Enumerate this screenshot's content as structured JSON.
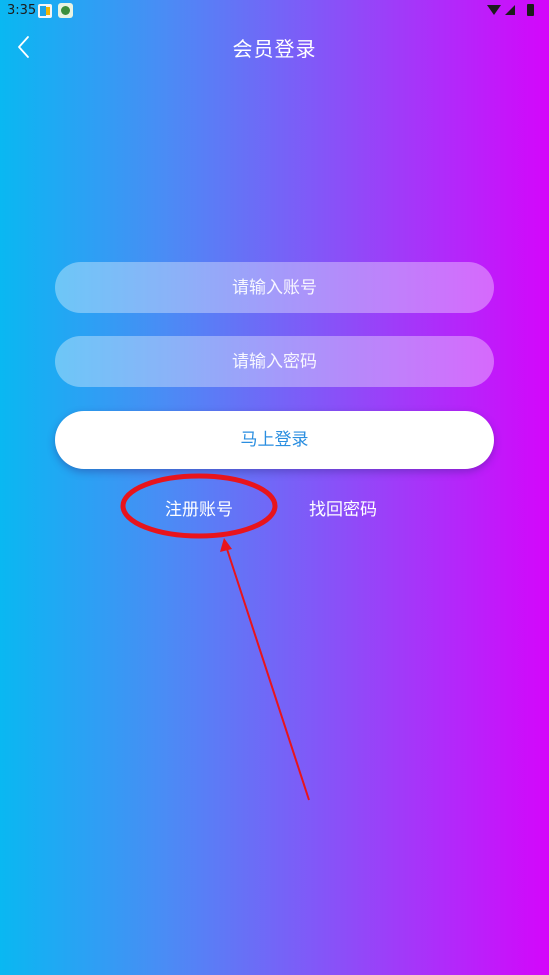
{
  "status_bar": {
    "time": "3:35",
    "icons": [
      "app-notification-icon",
      "app-notification-icon",
      "wifi-icon",
      "signal-icon",
      "battery-icon"
    ]
  },
  "header": {
    "back_icon": "chevron-left-icon",
    "title": "会员登录"
  },
  "form": {
    "account_placeholder": "请输入账号",
    "account_value": "",
    "password_placeholder": "请输入密码",
    "password_value": "",
    "login_label": "马上登录"
  },
  "links": {
    "register_label": "注册账号",
    "forgot_label": "找回密码"
  },
  "colors": {
    "gradient_left": "#09b8f2",
    "gradient_right": "#d406fb",
    "login_text": "#2a8ee0",
    "annotation_red": "#e8141c"
  }
}
